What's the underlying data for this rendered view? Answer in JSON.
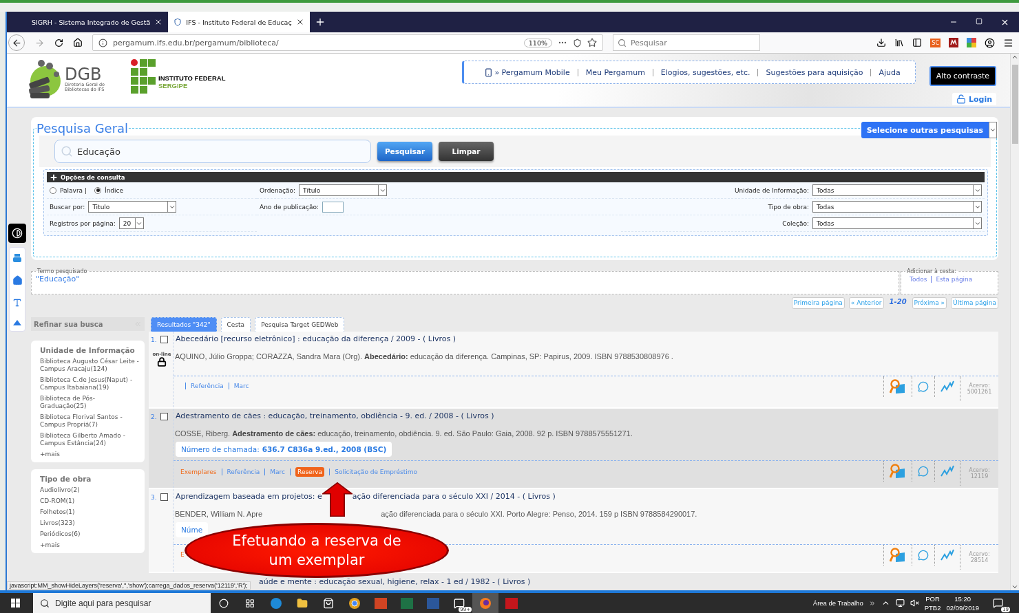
{
  "browser": {
    "tabs": [
      {
        "label": "SIGRH - Sistema Integrado de Gestã",
        "selected": false
      },
      {
        "label": "IFS - Instituto Federal de Educaç",
        "selected": true
      }
    ],
    "url": "pergamum.ifs.edu.br/pergamum/biblioteca/",
    "zoom": "110%",
    "search": {
      "placeholder": "Pesquisar"
    },
    "extension_label": "SC"
  },
  "header": {
    "dgb_logo": "DGB",
    "dgb_subtitle": "Diretoria Geral de Bibliotecas do IFS",
    "if_logo": [
      "INSTITUTO FEDERAL",
      "SERGIPE"
    ],
    "nav": [
      "» Pergamum Mobile",
      "Meu Pergamum",
      "Elogios, sugestões, etc.",
      "Sugestões para aquisição",
      "Ajuda"
    ],
    "contrast_button": "Alto contraste",
    "login": "Login"
  },
  "search_panel": {
    "title": "Pesquisa Geral",
    "other_searches": "Selecione outras pesquisas",
    "query": "Educação",
    "buttons": [
      "Pesquisar",
      "Limpar"
    ],
    "options_title": "Opções de consulta",
    "modes": [
      {
        "label": "Palavra |",
        "selected": false
      },
      {
        "label": "Índice",
        "selected": true
      }
    ],
    "left_fields": [
      {
        "label": "Buscar por:",
        "value": "Titulo",
        "kind": "select"
      },
      {
        "label": "Registros por página:",
        "value": "20",
        "kind": "small-select"
      }
    ],
    "middle_fields": [
      {
        "label": "Ordenação:",
        "value": "Título",
        "kind": "select"
      },
      {
        "label": "Ano de publicação:",
        "kind": "input"
      }
    ],
    "right_fields": [
      {
        "label": "Unidade de Informação:",
        "value": "Todas",
        "kind": "select"
      },
      {
        "label": "Tipo de obra:",
        "value": "Todas",
        "kind": "select"
      },
      {
        "label": "Coleção:",
        "value": "Todas",
        "kind": "select"
      }
    ]
  },
  "term": {
    "legend": "Termo pesquisado",
    "value": "\"Educação\""
  },
  "basket": {
    "legend": "Adicionar à cesta:",
    "links": [
      "Todos",
      "Esta página"
    ]
  },
  "pagination": [
    {
      "label": "Primeira página",
      "kind": "button"
    },
    {
      "label": "« Anterior",
      "kind": "button"
    },
    {
      "label": "1-20",
      "kind": "current"
    },
    {
      "label": "Próxima »",
      "kind": "button"
    },
    {
      "label": "Última página",
      "kind": "button"
    }
  ],
  "refine": {
    "title": "Refinar sua busca",
    "groups": [
      {
        "title": "Unidade de Informação",
        "items": [
          "Biblioteca Augusto César Leite - Campus Aracaju(124)",
          "Biblioteca C.de Jesus(Naput) - Campus Itabaiana(19)",
          "Biblioteca de Pós-Graduação(25)",
          "Biblioteca Florival Santos - Campus Propriá(7)",
          "Biblioteca Gilberto Amado - Campus Estância(24)"
        ],
        "more": "+mais"
      },
      {
        "title": "Tipo de obra",
        "items": [
          "Audiolivro(2)",
          "CD-ROM(1)",
          "Folhetos(1)",
          "Livros(323)",
          "Periódicos(6)"
        ],
        "more": "+mais"
      }
    ]
  },
  "result_tabs": [
    {
      "label": "Resultados \"342\"",
      "selected": true
    },
    {
      "label": "Cesta",
      "selected": false
    },
    {
      "label": "Pesquisa Target GEDWeb",
      "selected": false
    }
  ],
  "results": [
    {
      "number": "1.",
      "checked": false,
      "highlighted": false,
      "online_badge": "on-line",
      "title_parts": [
        "Abecedário [recurso eletrônico] : educação da diferença / 2009 - ( Livros )"
      ],
      "reference_parts": [
        "AQUINO, Júlio Groppa; CORAZZA, Sandra Mara (Org). **Abecedário:** educação da diferença. Campinas, SP: Papirus, 2009. ISBN 9788530808976 ."
      ],
      "leading_divider": true,
      "actions": [
        {
          "label": "Referência",
          "kind": "link"
        },
        {
          "label": "Marc",
          "kind": "link"
        }
      ],
      "acervo_label": "Acervo:",
      "acervo": "5001261"
    },
    {
      "number": "2.",
      "checked": false,
      "highlighted": true,
      "title_parts": [
        "Adestramento de cães : educação, treinamento, obdiência - 9. ed. / 2008 - ( Livros )"
      ],
      "reference_parts": [
        "COSSE, Riberg. **Adestramento de cães:** educação, treinamento, obdiência. 9. ed. São Paulo: Gaia, 2008. 92 p. ISBN 9788575551271."
      ],
      "call_number": {
        "label": "Número de chamada:",
        "value": "636.7 C836a 9.ed., 2008 (BSC)"
      },
      "leading_divider": false,
      "actions": [
        {
          "label": "Exemplares",
          "kind": "primary"
        },
        {
          "label": "Referência",
          "kind": "link"
        },
        {
          "label": "Marc",
          "kind": "link"
        },
        {
          "label": "Reserva",
          "kind": "active"
        },
        {
          "label": "Solicitação de Empréstimo",
          "kind": "link"
        }
      ],
      "acervo_label": "Acervo:",
      "acervo": "12119"
    },
    {
      "number": "3.",
      "checked": false,
      "highlighted": false,
      "title_parts": [
        "Aprendizagem baseada em projetos: e",
        "ação diferenciada para o século XXI / 2014 - ( Livros )"
      ],
      "reference_parts": [
        "BENDER, William N. Apre",
        "ação diferenciada para o século XXI. Porto Alegre: Penso, 2014. 159 p ISBN 9788584290017."
      ],
      "call_number": {
        "label": "Núme"
      },
      "leading_divider": false,
      "actions": [
        {
          "label": "E",
          "kind": "primary"
        }
      ],
      "acervo_label": "Acervo:",
      "acervo": "28514"
    }
  ],
  "cut_result": {
    "title": "aúde e mente : educação sexual, higiene, relax - 1 ed / 1982 - ( Livros )"
  },
  "annotation": {
    "text": "Efetuando a reserva de um exemplar"
  },
  "status_text": "javascript:MM_showHideLayers('reserva','','show');carrega_dados_reserva('12119','R');",
  "taskbar": {
    "search": {
      "placeholder": "Digite aqui para pesquisar"
    },
    "mail_badge": "99+",
    "desktop_label": "Área de Trabalho",
    "language": [
      "POR",
      "PTB2"
    ],
    "time": "15:20",
    "date": "02/09/2019",
    "notifications": "19"
  }
}
